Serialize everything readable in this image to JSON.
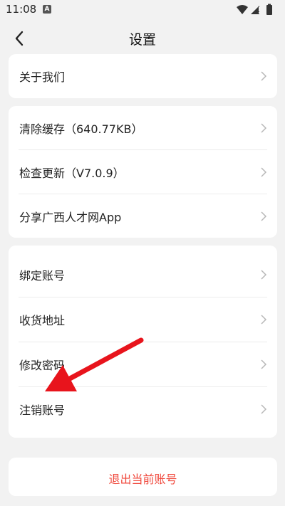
{
  "status_bar": {
    "time": "11:08",
    "notification_badge": "A",
    "icons": [
      "wifi-icon",
      "signal-icon",
      "battery-icon"
    ]
  },
  "header": {
    "title": "设置",
    "back_icon": "chevron-left-icon"
  },
  "sections": [
    {
      "items": [
        {
          "label": "关于我们"
        }
      ]
    },
    {
      "items": [
        {
          "label": "清除缓存（640.77KB）"
        },
        {
          "label": "检查更新（V7.0.9）"
        },
        {
          "label": "分享广西人才网App"
        }
      ]
    },
    {
      "items": [
        {
          "label": "绑定账号"
        },
        {
          "label": "收货地址"
        },
        {
          "label": "修改密码"
        },
        {
          "label": "注销账号"
        }
      ]
    }
  ],
  "logout": {
    "label": "退出当前账号"
  },
  "colors": {
    "background": "#f2f2f2",
    "card": "#ffffff",
    "logout_text": "#f04a3e",
    "annotation_arrow": "#e8141c",
    "chevron": "#b8b8b8"
  }
}
